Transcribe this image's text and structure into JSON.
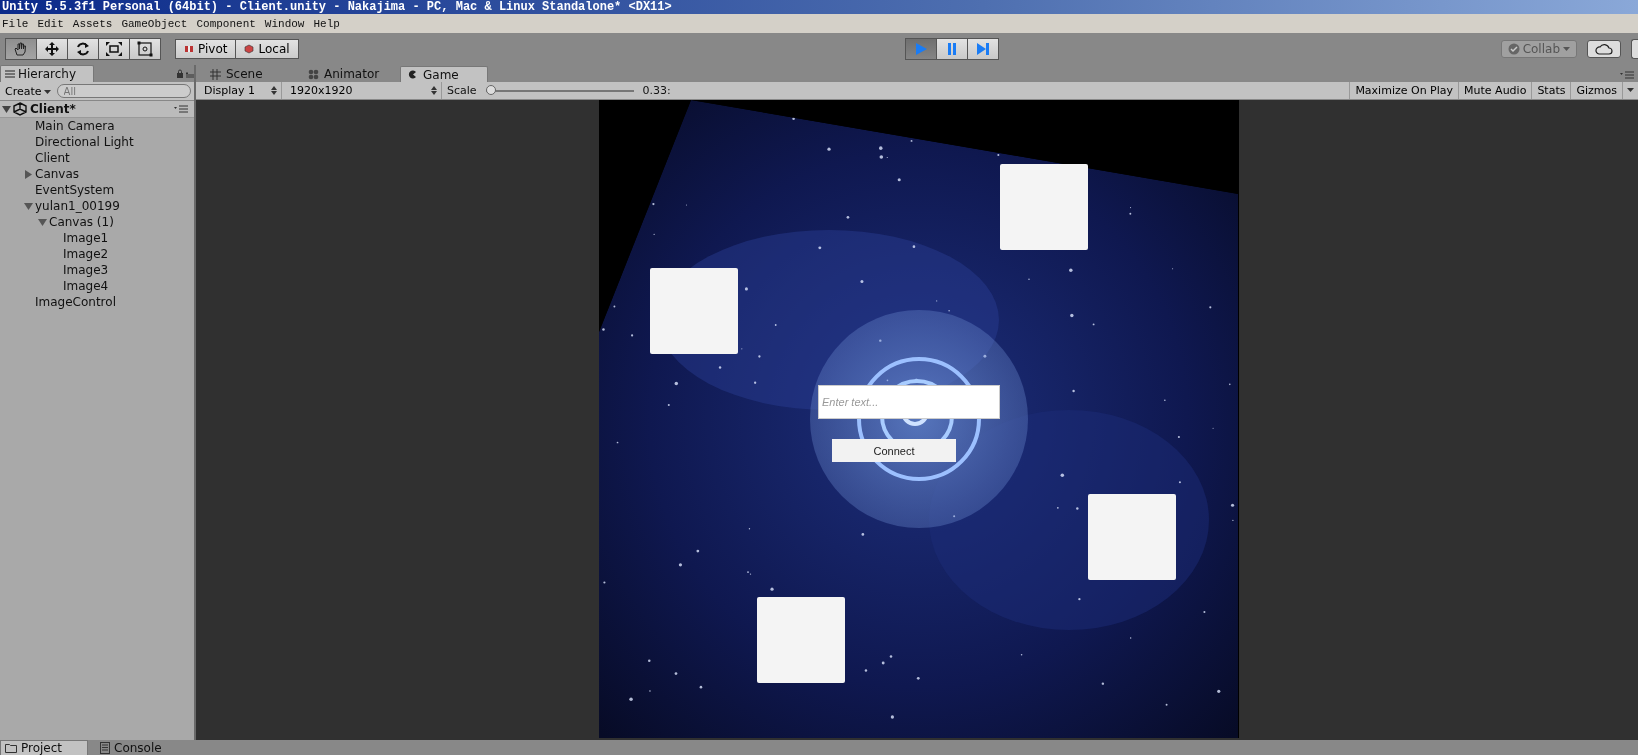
{
  "window": {
    "title": "Unity 5.5.3f1 Personal (64bit) - Client.unity - Nakajima - PC, Mac & Linux Standalone* <DX11>"
  },
  "menu": [
    "File",
    "Edit",
    "Assets",
    "GameObject",
    "Component",
    "Window",
    "Help"
  ],
  "transform_tools": [
    {
      "kind": "hand",
      "selected": true
    },
    {
      "kind": "move",
      "selected": false
    },
    {
      "kind": "rotate",
      "selected": false
    },
    {
      "kind": "scale",
      "selected": false
    },
    {
      "kind": "rect",
      "selected": false
    }
  ],
  "pivot_buttons": [
    {
      "label": "Pivot",
      "kind": "pivot"
    },
    {
      "label": "Local",
      "kind": "local"
    }
  ],
  "play_controls": [
    {
      "kind": "play",
      "selected": true
    },
    {
      "kind": "pause",
      "selected": false
    },
    {
      "kind": "step",
      "selected": false
    }
  ],
  "collab": {
    "label": "Collab"
  },
  "hierarchy": {
    "tab": "Hierarchy",
    "create": "Create",
    "search_placeholder": "All",
    "tree": {
      "label": "Client*",
      "expanded": true,
      "children": [
        {
          "label": "Main Camera"
        },
        {
          "label": "Directional Light"
        },
        {
          "label": "Client"
        },
        {
          "label": "Canvas",
          "expanded": false
        },
        {
          "label": "EventSystem"
        },
        {
          "label": "yulan1_00199",
          "expanded": true,
          "children": [
            {
              "label": "Canvas (1)",
              "expanded": true,
              "children": [
                {
                  "label": "Image1"
                },
                {
                  "label": "Image2"
                },
                {
                  "label": "Image3"
                },
                {
                  "label": "Image4"
                }
              ]
            }
          ]
        },
        {
          "label": "ImageControl"
        }
      ]
    }
  },
  "view_tabs": [
    {
      "label": "Scene",
      "kind": "scene",
      "selected": false
    },
    {
      "label": "Animator",
      "kind": "animator",
      "selected": false
    },
    {
      "label": "Game",
      "kind": "game",
      "selected": true
    }
  ],
  "game_toolbar": {
    "display": "Display 1",
    "resolution": "1920x1920",
    "scale_label": "Scale",
    "scale": {
      "level": 0.0
    },
    "scale_reading": "0.33:",
    "toggles": [
      {
        "label": "Maximize On Play",
        "on": false
      },
      {
        "label": "Mute Audio",
        "on": false
      },
      {
        "label": "Stats",
        "on": false
      },
      {
        "label": "Gizmos",
        "on": false
      }
    ]
  },
  "game": {
    "input": {
      "placeholder": "Enter text..."
    },
    "button": "Connect"
  },
  "bottom_tabs": [
    {
      "label": "Project",
      "kind": "project",
      "selected": true
    },
    {
      "label": "Console",
      "kind": "console",
      "selected": false
    }
  ]
}
